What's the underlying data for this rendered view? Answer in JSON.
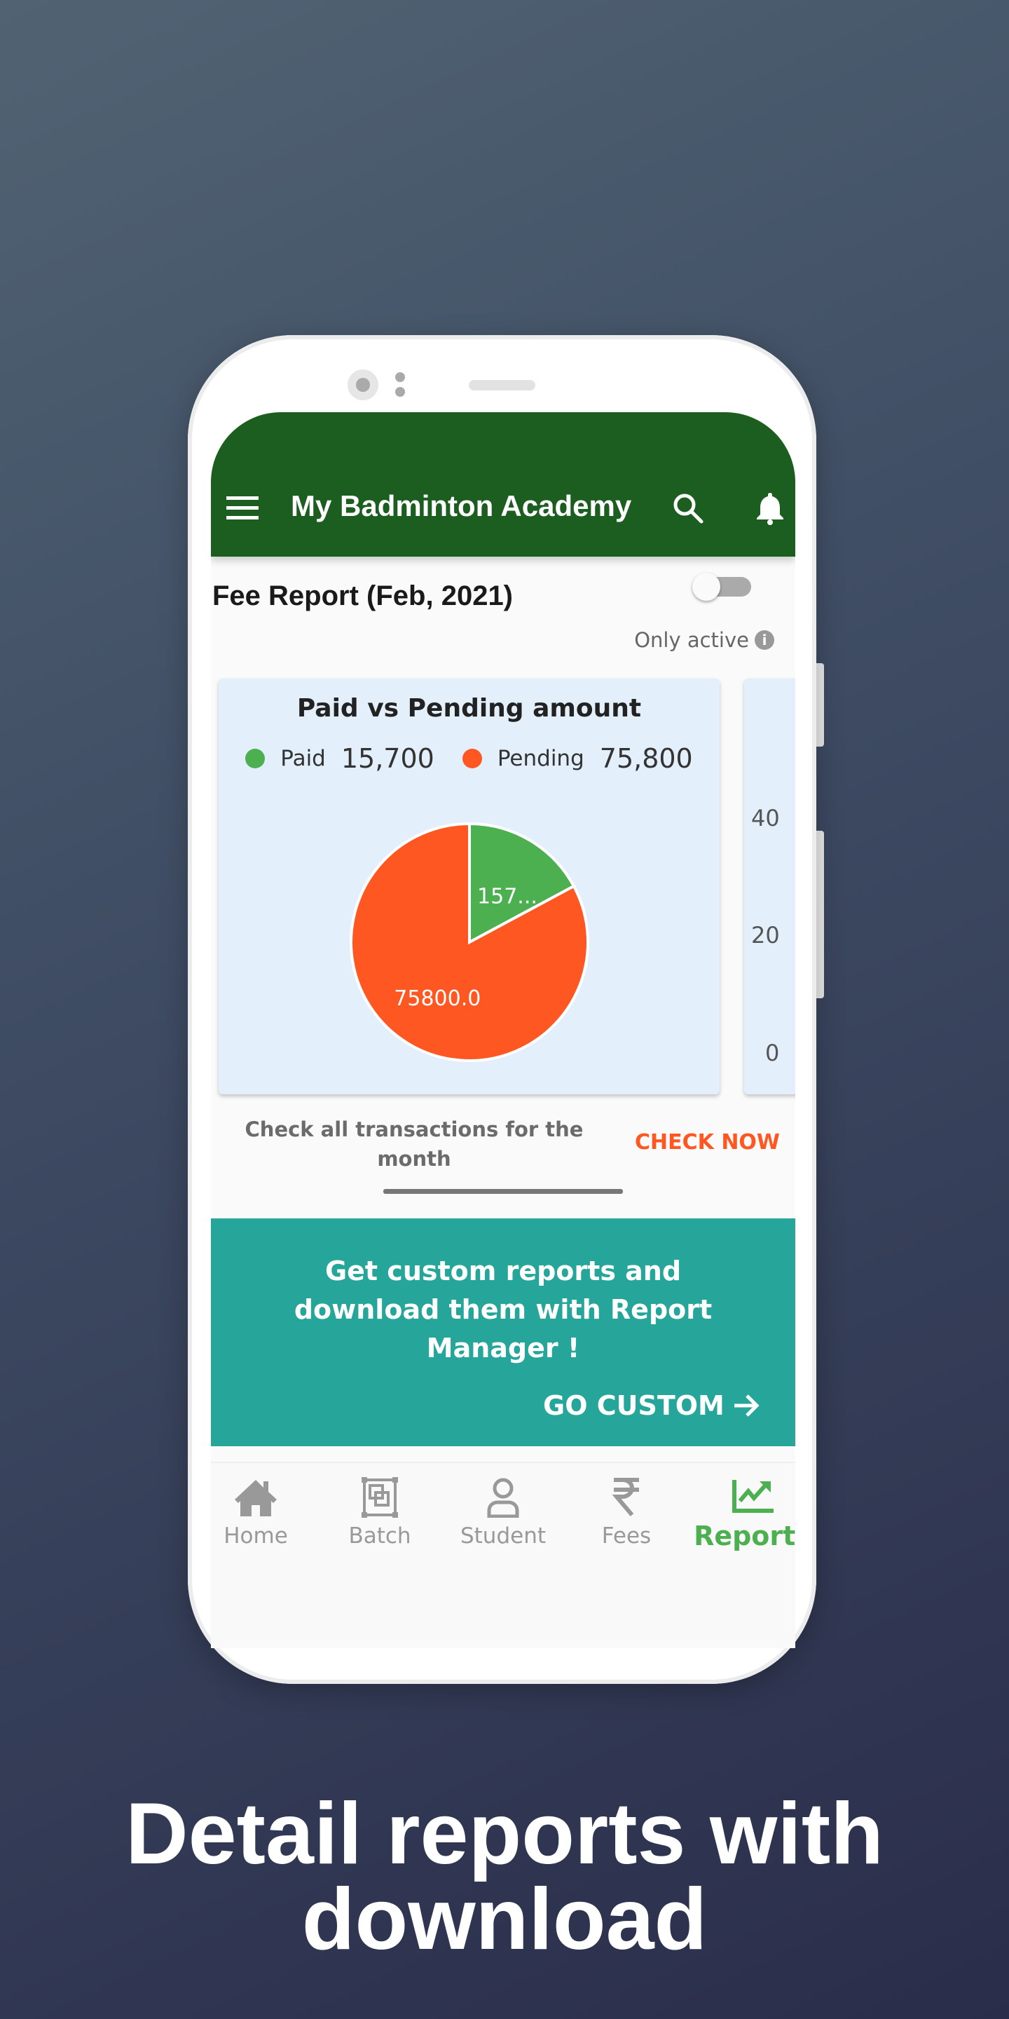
{
  "app": {
    "title": "My Badminton Academy"
  },
  "report": {
    "title": "Fee Report (Feb, 2021)",
    "only_active_label": "Only active",
    "only_active_on": false
  },
  "pie_card": {
    "title": "Paid vs Pending amount",
    "legend": [
      {
        "label": "Paid",
        "value": "15,700",
        "color": "#4caf50"
      },
      {
        "label": "Pending",
        "value": "75,800",
        "color": "#ff5722"
      }
    ],
    "slice_labels": [
      "157...",
      "75800.0"
    ]
  },
  "second_card": {
    "yticks": [
      "40",
      "20",
      "0"
    ]
  },
  "check": {
    "text": "Check all transactions for the month",
    "action": "CHECK NOW"
  },
  "banner": {
    "text": "Get custom reports and download them with Report Manager !",
    "action": "GO CUSTOM"
  },
  "nav": [
    {
      "label": "Home",
      "icon": "home-icon"
    },
    {
      "label": "Batch",
      "icon": "batch-icon"
    },
    {
      "label": "Student",
      "icon": "person-icon"
    },
    {
      "label": "Fees",
      "icon": "rupee-icon"
    },
    {
      "label": "Reports",
      "icon": "chart-trend-icon",
      "active": true
    }
  ],
  "caption": {
    "line1": "Detail reports with",
    "line2": "download"
  },
  "colors": {
    "appbar": "#1b5e20",
    "paid": "#4caf50",
    "pending": "#ff5722",
    "banner": "#26a69a",
    "active_nav": "#4caf50"
  },
  "chart_data": [
    {
      "type": "pie",
      "title": "Paid vs Pending amount",
      "categories": [
        "Paid",
        "Pending"
      ],
      "values": [
        15700,
        75800
      ],
      "colors": [
        "#4caf50",
        "#ff5722"
      ],
      "legend": "top"
    },
    {
      "type": "bar",
      "yticks": [
        0,
        20,
        40
      ]
    }
  ]
}
